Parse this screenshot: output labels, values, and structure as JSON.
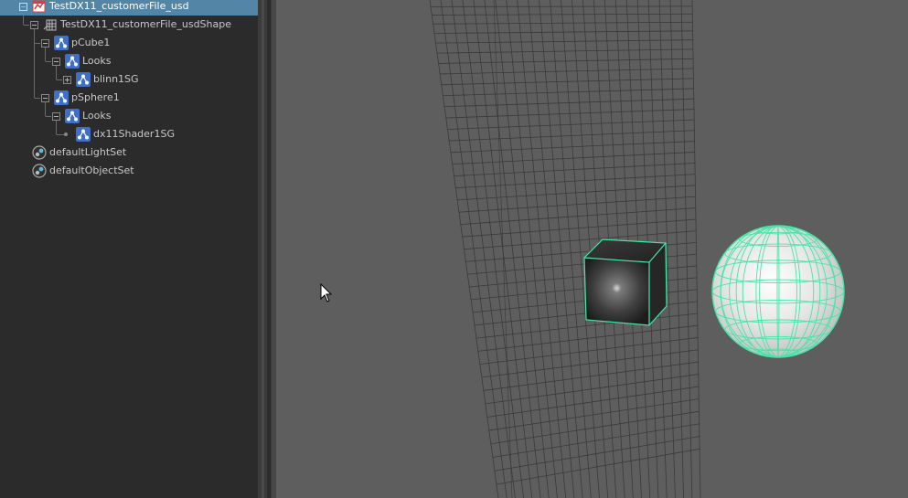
{
  "outliner": {
    "items": [
      {
        "label": "TestDX11_customerFile_usd",
        "icon": "usd-proxy-icon",
        "selected": true
      },
      {
        "label": "TestDX11_customerFile_usdShape",
        "icon": "usd-shape-icon"
      },
      {
        "label": "pCube1",
        "icon": "usd-prim-icon"
      },
      {
        "label": "Looks",
        "icon": "usd-prim-icon"
      },
      {
        "label": "blinn1SG",
        "icon": "usd-prim-icon"
      },
      {
        "label": "pSphere1",
        "icon": "usd-prim-icon"
      },
      {
        "label": "Looks",
        "icon": "usd-prim-icon"
      },
      {
        "label": "dx11Shader1SG",
        "icon": "usd-prim-icon"
      },
      {
        "label": "defaultLightSet",
        "icon": "set-icon"
      },
      {
        "label": "defaultObjectSet",
        "icon": "set-icon"
      }
    ]
  },
  "colors": {
    "selection": "#5285a6",
    "outliner_bg": "#2b2b2b",
    "viewport_bg": "#5e5e5e",
    "wireframe_highlight": "#44e6a6",
    "grid_line": "#3a3a3a"
  },
  "viewport": {
    "objects": [
      "pCube1",
      "pSphere1"
    ],
    "cursor": "arrow-cursor"
  }
}
